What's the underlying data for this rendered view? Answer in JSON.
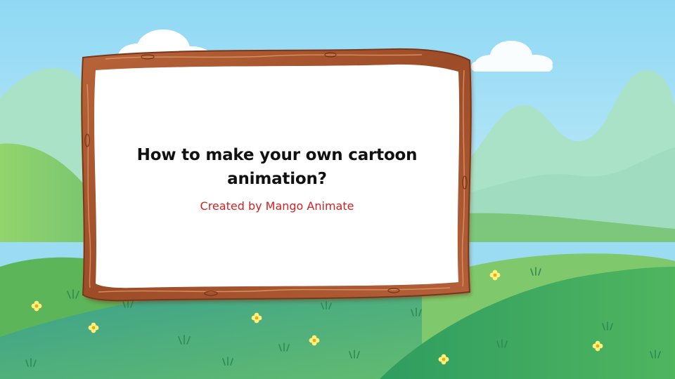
{
  "slide": {
    "title": "How to make your own cartoon animation?",
    "subtitle": "Created by Mango Animate"
  },
  "colors": {
    "sky_top": "#8fd8f4",
    "sky_bottom": "#d7f4fb",
    "far_hills": "#a9e2c6",
    "water": "#9bdcf3",
    "grass_light": "#7ec86a",
    "grass_dark": "#3e9e5c",
    "frame_wood": "#a8532d",
    "title_text": "#111111",
    "subtitle_text": "#d42121"
  },
  "decorations": {
    "frame": "wooden-frame",
    "flower_icon": "yellow-flower-icon",
    "grass_tuft_icon": "grass-tuft-icon"
  }
}
